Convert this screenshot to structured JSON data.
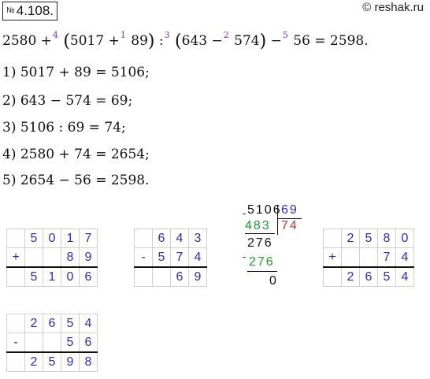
{
  "header": {
    "number_sign": "№",
    "problem_number": "4.108.",
    "site": "© reshak.ru"
  },
  "expression": {
    "p1": "2580 +",
    "o1": "4",
    "p2": "(",
    "p3": "5017 +",
    "o2": "1",
    "p4": "89",
    "p5": ")",
    "p6": ":",
    "o3": "3",
    "p7": "(",
    "p8": "643 −",
    "o4": "2",
    "p9": "574",
    "p10": ")",
    "p11": "−",
    "o5": "5",
    "p12": "56 = 2598."
  },
  "steps": [
    "1) 5017 + 89 = 5106;",
    "2) 643 − 574 = 69;",
    "3) 5106 : 69 = 74;",
    "4) 2580 + 74 = 2654;",
    "5) 2654 − 56 = 2598."
  ],
  "columns": [
    {
      "op": "+",
      "rows": [
        [
          "5",
          "0",
          "1",
          "7"
        ],
        [
          "",
          "",
          "8",
          "9"
        ],
        [
          "5",
          "1",
          "0",
          "6"
        ]
      ]
    },
    {
      "op": "-",
      "rows": [
        [
          "6",
          "4",
          "3"
        ],
        [
          "5",
          "7",
          "4"
        ],
        [
          "",
          "6",
          "9"
        ]
      ]
    },
    {
      "op": "+",
      "rows": [
        [
          "2",
          "5",
          "8",
          "0"
        ],
        [
          "",
          "",
          "7",
          "4"
        ],
        [
          "2",
          "6",
          "5",
          "4"
        ]
      ]
    },
    {
      "op": "-",
      "rows": [
        [
          "2",
          "6",
          "5",
          "4"
        ],
        [
          "",
          "",
          "5",
          "6"
        ],
        [
          "2",
          "5",
          "9",
          "8"
        ]
      ]
    }
  ],
  "division": {
    "dividend": "5106",
    "divisor": "69",
    "quotient": "74",
    "sub1": "483",
    "rem1": "276",
    "sub2": "276",
    "rem2": "0",
    "minus1": "-",
    "minus2": "-"
  },
  "colors": {
    "digits": "#2a2ad0",
    "green": "#1f9a2f",
    "red": "#c0392b",
    "op_index": "#7a2fbf"
  }
}
